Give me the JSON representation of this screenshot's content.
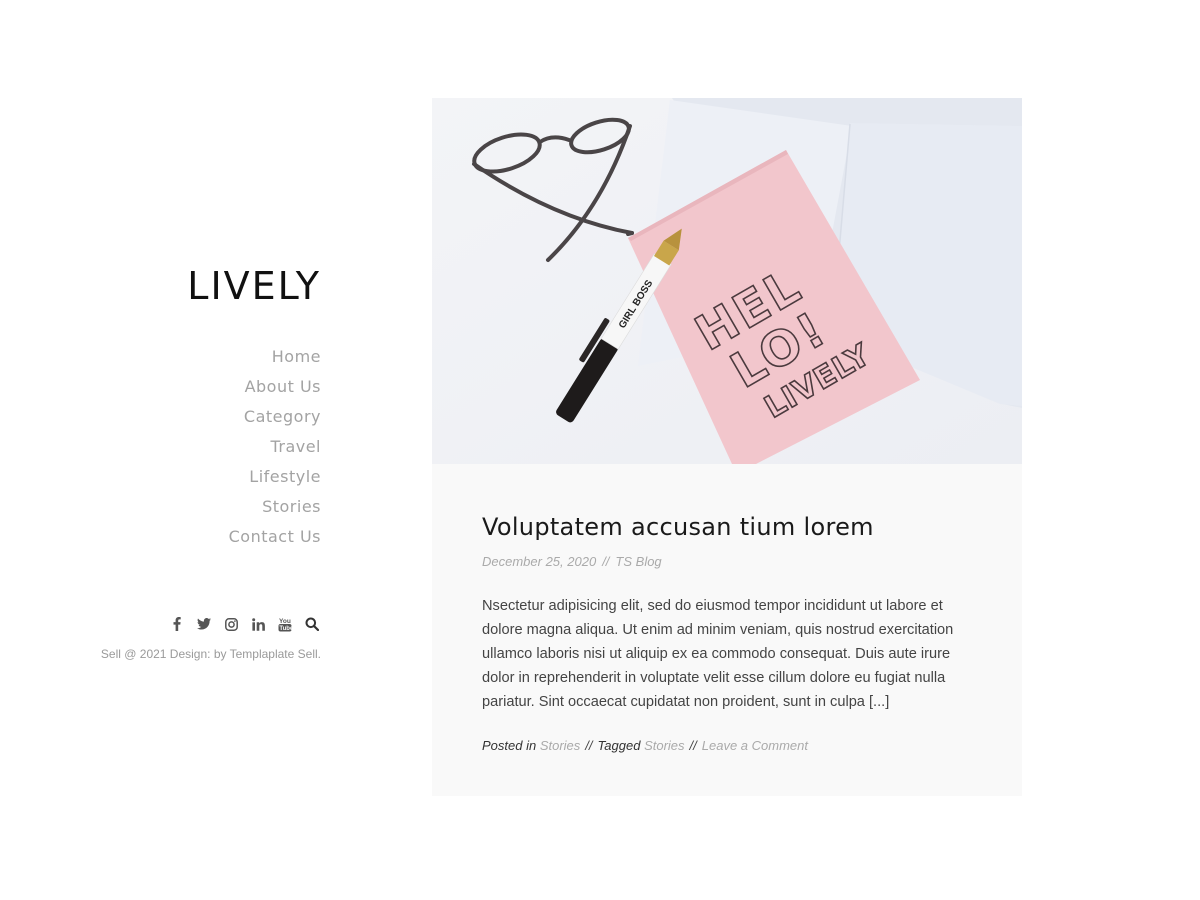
{
  "site": {
    "title": "LIVELY"
  },
  "nav": {
    "items": [
      {
        "label": "Home"
      },
      {
        "label": "About Us"
      },
      {
        "label": "Category"
      },
      {
        "label": "Travel"
      },
      {
        "label": "Lifestyle"
      },
      {
        "label": "Stories"
      },
      {
        "label": "Contact Us"
      }
    ]
  },
  "social": {
    "icons": [
      "facebook-icon",
      "twitter-icon",
      "instagram-icon",
      "linkedin-icon",
      "youtube-icon",
      "search-icon"
    ]
  },
  "footer": {
    "copyright": "Sell @ 2021 Design: by Templaplate Sell."
  },
  "post": {
    "title": "Voluptatem accusan tium lorem",
    "date": "December 25, 2020",
    "date_separator": "//",
    "author": "TS Blog",
    "excerpt": "Nsectetur adipisicing elit, sed do eiusmod tempor incididunt ut labore et dolore magna aliqua. Ut enim ad minim veniam, quis nostrud exercitation ullamco laboris nisi ut aliquip ex ea commodo consequat. Duis aute irure dolor in reprehenderit in voluptate velit esse cillum dolore eu fugiat nulla pariatur. Sint occaecat cupidatat non proident, sunt in culpa [...]",
    "posted_in_label": "Posted in",
    "category": "Stories",
    "sep1": "//",
    "tagged_label": "Tagged",
    "tag": "Stories",
    "sep2": "//",
    "comment_link": "Leave a Comment",
    "image": {
      "notebook_text_line1": "HEL",
      "notebook_text_line2": "LO!",
      "notebook_text_line3": "LIVELY",
      "pen_text": "GIRL BOSS"
    }
  },
  "colors": {
    "nav_text": "#a3a3a3",
    "card_background": "#f9f9f9",
    "notebook_pink": "#f2c6cc",
    "meta_text": "#aaaaaa"
  }
}
